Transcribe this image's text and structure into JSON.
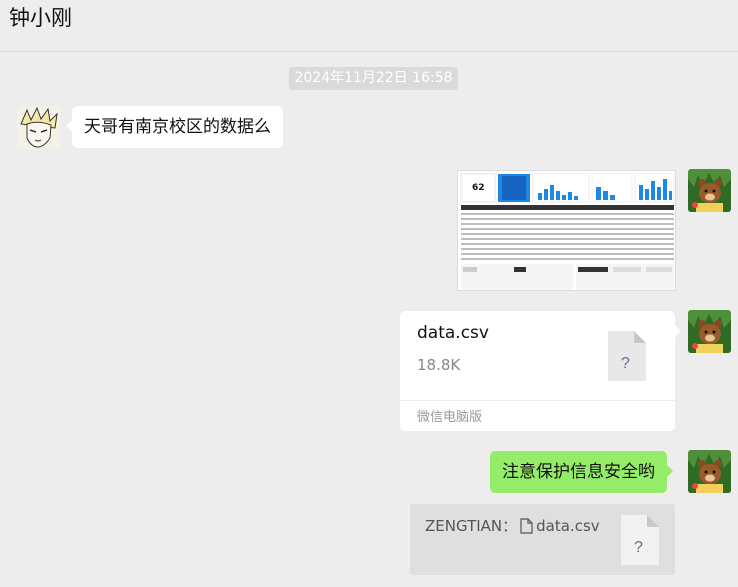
{
  "header": {
    "title": "钟小刚"
  },
  "timestamp": "2024年11月22日 16:58",
  "messages": {
    "incoming_text": "天哥有南京校区的数据么",
    "outgoing_image": {
      "kpi_value": "62"
    },
    "file": {
      "name": "data.csv",
      "size": "18.8K",
      "source": "微信电脑版",
      "icon_glyph": "?"
    },
    "outgoing_text": "注意保护信息安全哟",
    "quote": {
      "sender": "ZENGTIAN：",
      "file_name": "data.csv",
      "icon_glyph": "?"
    }
  },
  "icons": {
    "contact_avatar": "anime-avatar-icon",
    "self_avatar": "bear-cartoon-avatar-icon",
    "file_doc": "unknown-file-icon",
    "inline_file": "file-icon"
  },
  "colors": {
    "background": "#ededed",
    "incoming_bubble": "#ffffff",
    "outgoing_bubble": "#95ec69",
    "timestamp_bg": "#dadada",
    "quote_bg": "#dfdfdf",
    "chart_accent": "#1e88e5"
  }
}
